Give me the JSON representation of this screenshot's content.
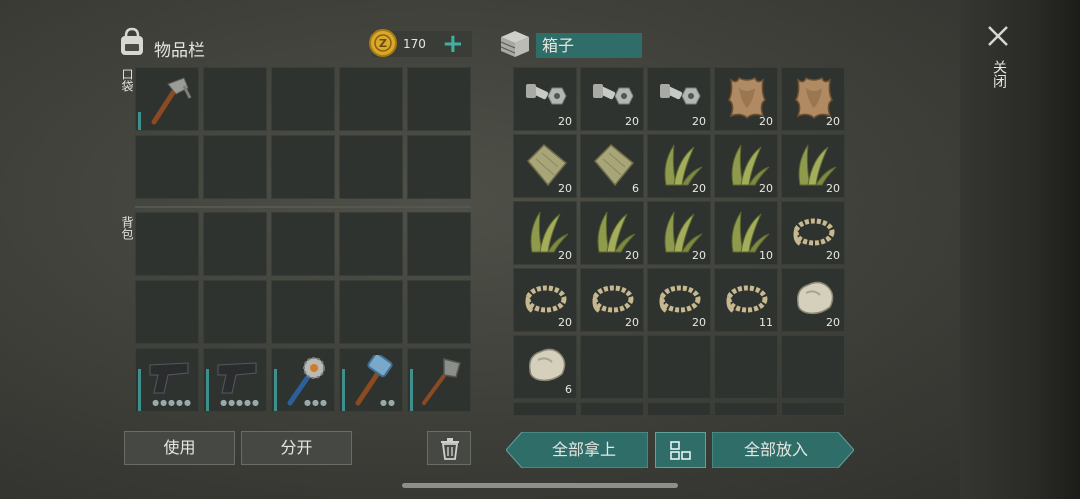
{
  "inventory": {
    "title": "物品栏",
    "coins": "170",
    "pocket_label": "口袋",
    "backpack_label": "背包",
    "use_label": "使用",
    "split_label": "分开"
  },
  "box": {
    "title": "箱子",
    "items": [
      {
        "icon": "bolt-icon",
        "qty": "20"
      },
      {
        "icon": "bolt-icon",
        "qty": "20"
      },
      {
        "icon": "bolt-icon",
        "qty": "20"
      },
      {
        "icon": "leather-icon",
        "qty": "20"
      },
      {
        "icon": "leather-icon",
        "qty": "20"
      },
      {
        "icon": "cloth-icon",
        "qty": "20"
      },
      {
        "icon": "cloth-icon",
        "qty": "6"
      },
      {
        "icon": "plant-fiber-icon",
        "qty": "20"
      },
      {
        "icon": "plant-fiber-icon",
        "qty": "20"
      },
      {
        "icon": "plant-fiber-icon",
        "qty": "20"
      },
      {
        "icon": "plant-fiber-icon",
        "qty": "20"
      },
      {
        "icon": "plant-fiber-icon",
        "qty": "20"
      },
      {
        "icon": "plant-fiber-icon",
        "qty": "20"
      },
      {
        "icon": "plant-fiber-icon",
        "qty": "10"
      },
      {
        "icon": "rope-icon",
        "qty": "20"
      },
      {
        "icon": "rope-icon",
        "qty": "20"
      },
      {
        "icon": "rope-icon",
        "qty": "20"
      },
      {
        "icon": "rope-icon",
        "qty": "20"
      },
      {
        "icon": "rope-icon",
        "qty": "11"
      },
      {
        "icon": "stone-icon",
        "qty": "20"
      },
      {
        "icon": "stone-icon",
        "qty": "6"
      }
    ],
    "take_all_label": "全部拿上",
    "put_all_label": "全部放入"
  },
  "close_label": "关闭",
  "colors": {
    "accent": "#2f6d69",
    "panel": "#2f332f"
  }
}
